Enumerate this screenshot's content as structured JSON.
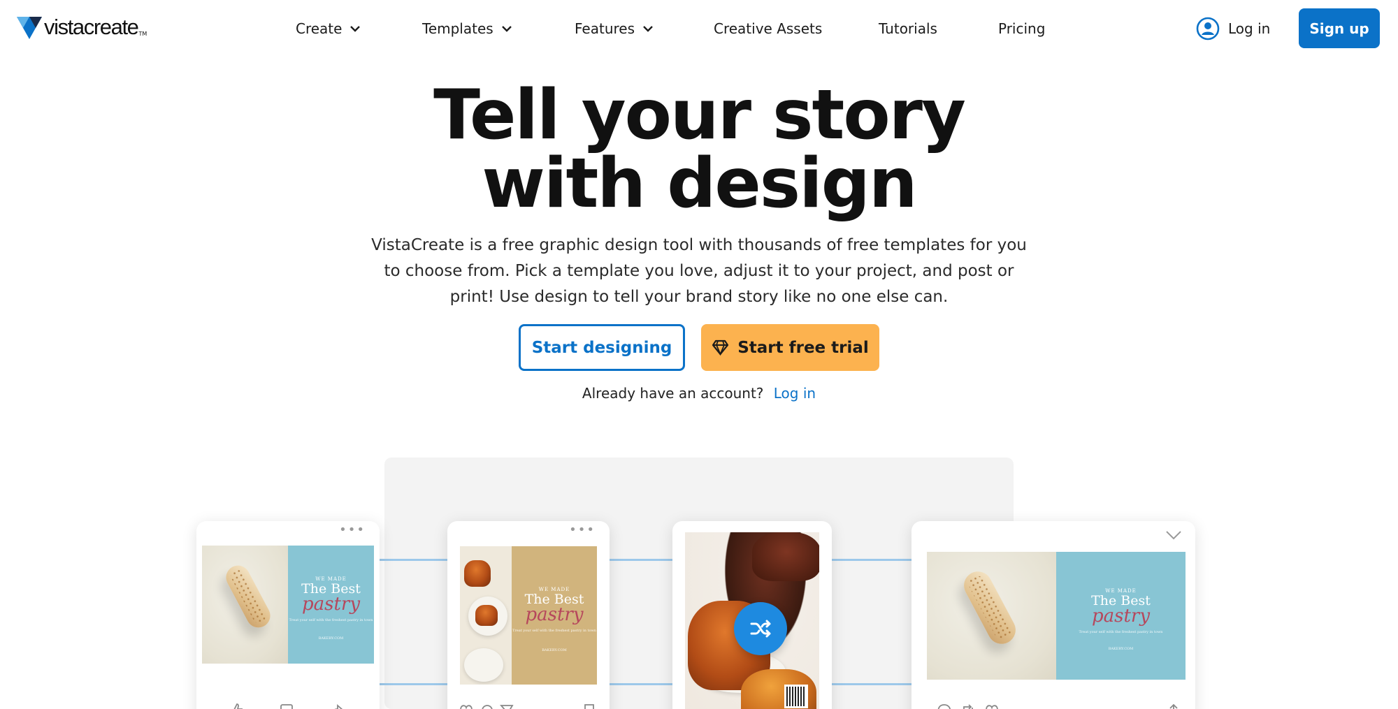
{
  "brand": {
    "logo_text": "vistacreate",
    "logo_tm": "TM",
    "accent": "#0b72c8",
    "trial_color": "#fcb24f"
  },
  "nav": {
    "items": [
      {
        "label": "Create",
        "has_dropdown": true
      },
      {
        "label": "Templates",
        "has_dropdown": true
      },
      {
        "label": "Features",
        "has_dropdown": true
      },
      {
        "label": "Creative Assets",
        "has_dropdown": false
      },
      {
        "label": "Tutorials",
        "has_dropdown": false
      },
      {
        "label": "Pricing",
        "has_dropdown": false
      }
    ],
    "login_label": "Log in",
    "signup_label": "Sign up"
  },
  "hero": {
    "title_line1": "Tell your story",
    "title_line2": "with design",
    "description": "VistaCreate is a free graphic design tool with thousands of free templates for you to choose from. Pick a template you love, adjust it to your project, and post or print! Use design to tell your brand story like no one else can.",
    "start_designing": "Start designing",
    "start_trial": "Start free trial",
    "account_prompt": "Already have an account?",
    "account_login": "Log in"
  },
  "showcase": {
    "template": {
      "eyebrow": "WE MADE",
      "headline": "The Best",
      "script": "pastry",
      "fineprint": "Treat your self with the freshest pastry in town",
      "brand_line": "BAKERY.COM"
    },
    "icons": [
      "dots-icon",
      "chevron-down-icon",
      "shuffle-icon",
      "like-icon",
      "comment-icon",
      "share-icon",
      "bookmark-icon",
      "heart-icon",
      "retweet-icon",
      "upload-icon"
    ]
  }
}
